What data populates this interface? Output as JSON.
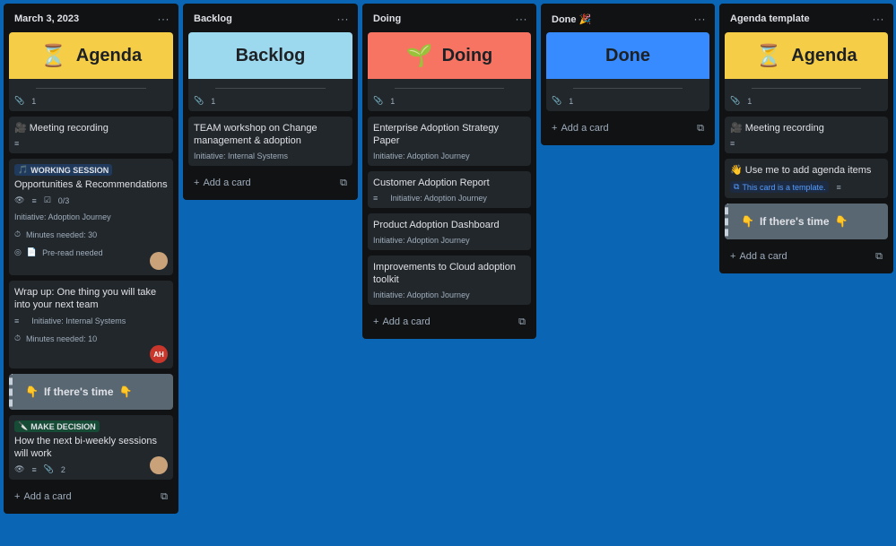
{
  "colors": {
    "board_bg": "#0a66b4",
    "list_bg": "#111214",
    "card_bg": "#22272b",
    "cover_yellow": "#f5cd47",
    "cover_cyan": "#9dd9ee",
    "cover_orange": "#f87462",
    "cover_blue": "#388bff"
  },
  "lists": [
    {
      "title": "March 3, 2023",
      "menu": "···",
      "cover": {
        "text": "Agenda",
        "emoji": "⏳",
        "attachments": "1"
      },
      "cards": [
        {
          "title": "Meeting recording",
          "emoji": "🎥"
        },
        {
          "label": "WORKING SESSION",
          "label_emoji": "🎵",
          "title": "Opportunities & Recommendations",
          "checklist": "0/3",
          "initiative": "Initiative: Adoption Journey",
          "minutes": "Minutes needed: 30",
          "preread": "Pre-read needed"
        },
        {
          "title": "Wrap up: One thing you will take into your next team",
          "initiative": "Initiative: Internal Systems",
          "minutes": "Minutes needed: 10",
          "avatar": "AH"
        },
        {
          "title": "If there's time",
          "emoji": "👇"
        },
        {
          "label": "MAKE DECISION",
          "label_emoji": "🔪",
          "title": "How the next bi-weekly sessions will work",
          "attachments": "2"
        }
      ],
      "add_card": "Add a card"
    },
    {
      "title": "Backlog",
      "menu": "···",
      "cover": {
        "text": "Backlog",
        "attachments": "1"
      },
      "cards": [
        {
          "title": "TEAM workshop on Change management & adoption",
          "initiative": "Initiative: Internal Systems"
        }
      ],
      "add_card": "Add a card"
    },
    {
      "title": "Doing",
      "menu": "···",
      "cover": {
        "text": "Doing",
        "emoji": "🌱",
        "attachments": "1"
      },
      "cards": [
        {
          "title": "Enterprise Adoption Strategy Paper",
          "initiative": "Initiative: Adoption Journey"
        },
        {
          "title": "Customer Adoption Report",
          "initiative": "Initiative: Adoption Journey"
        },
        {
          "title": "Product Adoption Dashboard",
          "initiative": "Initiative: Adoption Journey"
        },
        {
          "title": "Improvements to Cloud adoption toolkit",
          "initiative": "Initiative: Adoption Journey"
        }
      ],
      "add_card": "Add a card"
    },
    {
      "title": "Done",
      "title_emoji": "🎉",
      "menu": "···",
      "cover": {
        "text": "Done",
        "attachments": "1"
      },
      "cards": [],
      "add_card": "Add a card"
    },
    {
      "title": "Agenda template",
      "menu": "···",
      "cover": {
        "text": "Agenda",
        "emoji": "⏳",
        "attachments": "1"
      },
      "cards": [
        {
          "title": "Meeting recording",
          "emoji": "🎥"
        },
        {
          "title": "Use me to add agenda items",
          "emoji": "👋",
          "template": "This card is a template."
        },
        {
          "title": "If there's time",
          "emoji": "👇"
        }
      ],
      "add_card": "Add a card"
    }
  ]
}
